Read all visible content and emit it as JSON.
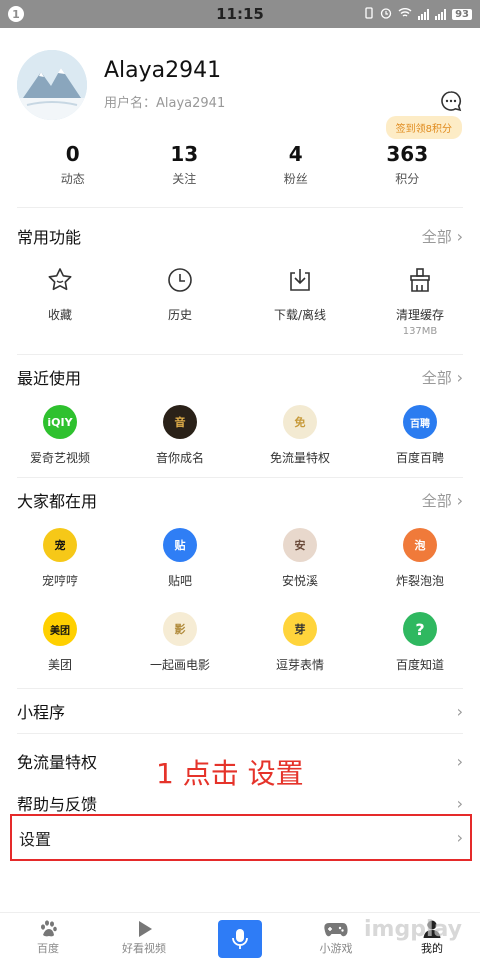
{
  "status_bar": {
    "notification_count": "1",
    "time": "11:15",
    "battery": "93",
    "icons": [
      "vibrate-icon",
      "alarm-icon",
      "wifi-icon",
      "signal-icon"
    ]
  },
  "profile": {
    "username": "Alaya2941",
    "sub_label": "用户名：Alaya2941",
    "signin_badge": "签到领8积分",
    "chat_icon": "chat-bubble-icon"
  },
  "stats": [
    {
      "value": "0",
      "label": "动态"
    },
    {
      "value": "13",
      "label": "关注"
    },
    {
      "value": "4",
      "label": "粉丝"
    },
    {
      "value": "363",
      "label": "积分"
    }
  ],
  "common_functions": {
    "title": "常用功能",
    "more": "全部",
    "items": [
      {
        "label": "收藏",
        "icon": "star-icon"
      },
      {
        "label": "历史",
        "icon": "clock-icon"
      },
      {
        "label": "下载/离线",
        "icon": "download-icon"
      },
      {
        "label": "清理缓存",
        "icon": "broom-icon",
        "sub": "137MB"
      }
    ]
  },
  "recent": {
    "title": "最近使用",
    "more": "全部",
    "items": [
      {
        "label": "爱奇艺视频",
        "icon": "iqiyi-icon",
        "color": "#2ec12e",
        "text": "iQIY"
      },
      {
        "label": "音你成名",
        "icon": "music-show-icon",
        "color": "#2a2118",
        "text": "音"
      },
      {
        "label": "免流量特权",
        "icon": "free-traffic-icon",
        "color": "#f3ead2",
        "text": "免"
      },
      {
        "label": "百度百聘",
        "icon": "baipin-icon",
        "color": "#2b7cf0",
        "text": "百聘"
      }
    ]
  },
  "popular": {
    "title": "大家都在用",
    "more": "全部",
    "rows": [
      [
        {
          "label": "宠哼哼",
          "icon": "pet-icon",
          "color": "#f6c818",
          "text": "宠"
        },
        {
          "label": "贴吧",
          "icon": "tieba-icon",
          "color": "#2f7ef5",
          "text": "贴"
        },
        {
          "label": "安悦溪",
          "icon": "avatar-icon",
          "color": "#e8d8cc",
          "text": "安"
        },
        {
          "label": "炸裂泡泡",
          "icon": "bubble-icon",
          "color": "#f07a3a",
          "text": "泡"
        }
      ],
      [
        {
          "label": "美团",
          "icon": "meituan-icon",
          "color": "#ffd000",
          "text": "美团"
        },
        {
          "label": "一起画电影",
          "icon": "film-icon",
          "color": "#f6ecd4",
          "text": "影"
        },
        {
          "label": "逗芽表情",
          "icon": "duck-icon",
          "color": "#ffd43b",
          "text": "芽"
        },
        {
          "label": "百度知道",
          "icon": "zhidao-icon",
          "color": "#2fb860",
          "text": "?"
        }
      ]
    ]
  },
  "rows": {
    "mini_program": "小程序",
    "free_traffic": "免流量特权",
    "help": "帮助与反馈",
    "settings": "设置",
    "chevron": "›"
  },
  "annotation": "1 点击 设置",
  "bottom_nav": [
    {
      "label": "百度",
      "icon": "paw-icon"
    },
    {
      "label": "好看视频",
      "icon": "play-icon"
    },
    {
      "label": "",
      "icon": "microphone-icon"
    },
    {
      "label": "小游戏",
      "icon": "gamepad-icon"
    },
    {
      "label": "我的",
      "icon": "person-icon"
    }
  ],
  "watermark": "imgplay"
}
